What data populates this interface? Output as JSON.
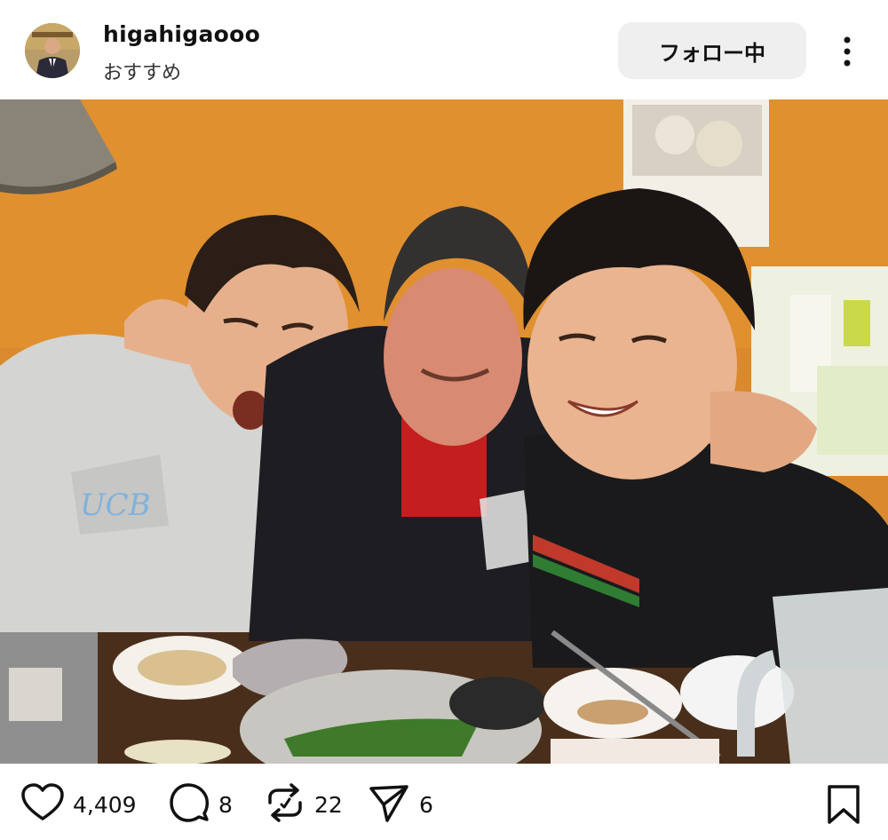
{
  "post": {
    "username": "higahigaooo",
    "subtitle": "おすすめ",
    "follow_label": "フォロー中"
  },
  "actions": {
    "likes": "4,409",
    "comments": "8",
    "reposts": "22",
    "shares": "6"
  },
  "colors": {
    "wall": "#d98a2e",
    "follow_bg": "#efefef",
    "text": "#111111"
  },
  "icons": [
    "more-options-icon",
    "heart-icon",
    "comment-icon",
    "repost-icon",
    "share-icon",
    "bookmark-icon"
  ]
}
